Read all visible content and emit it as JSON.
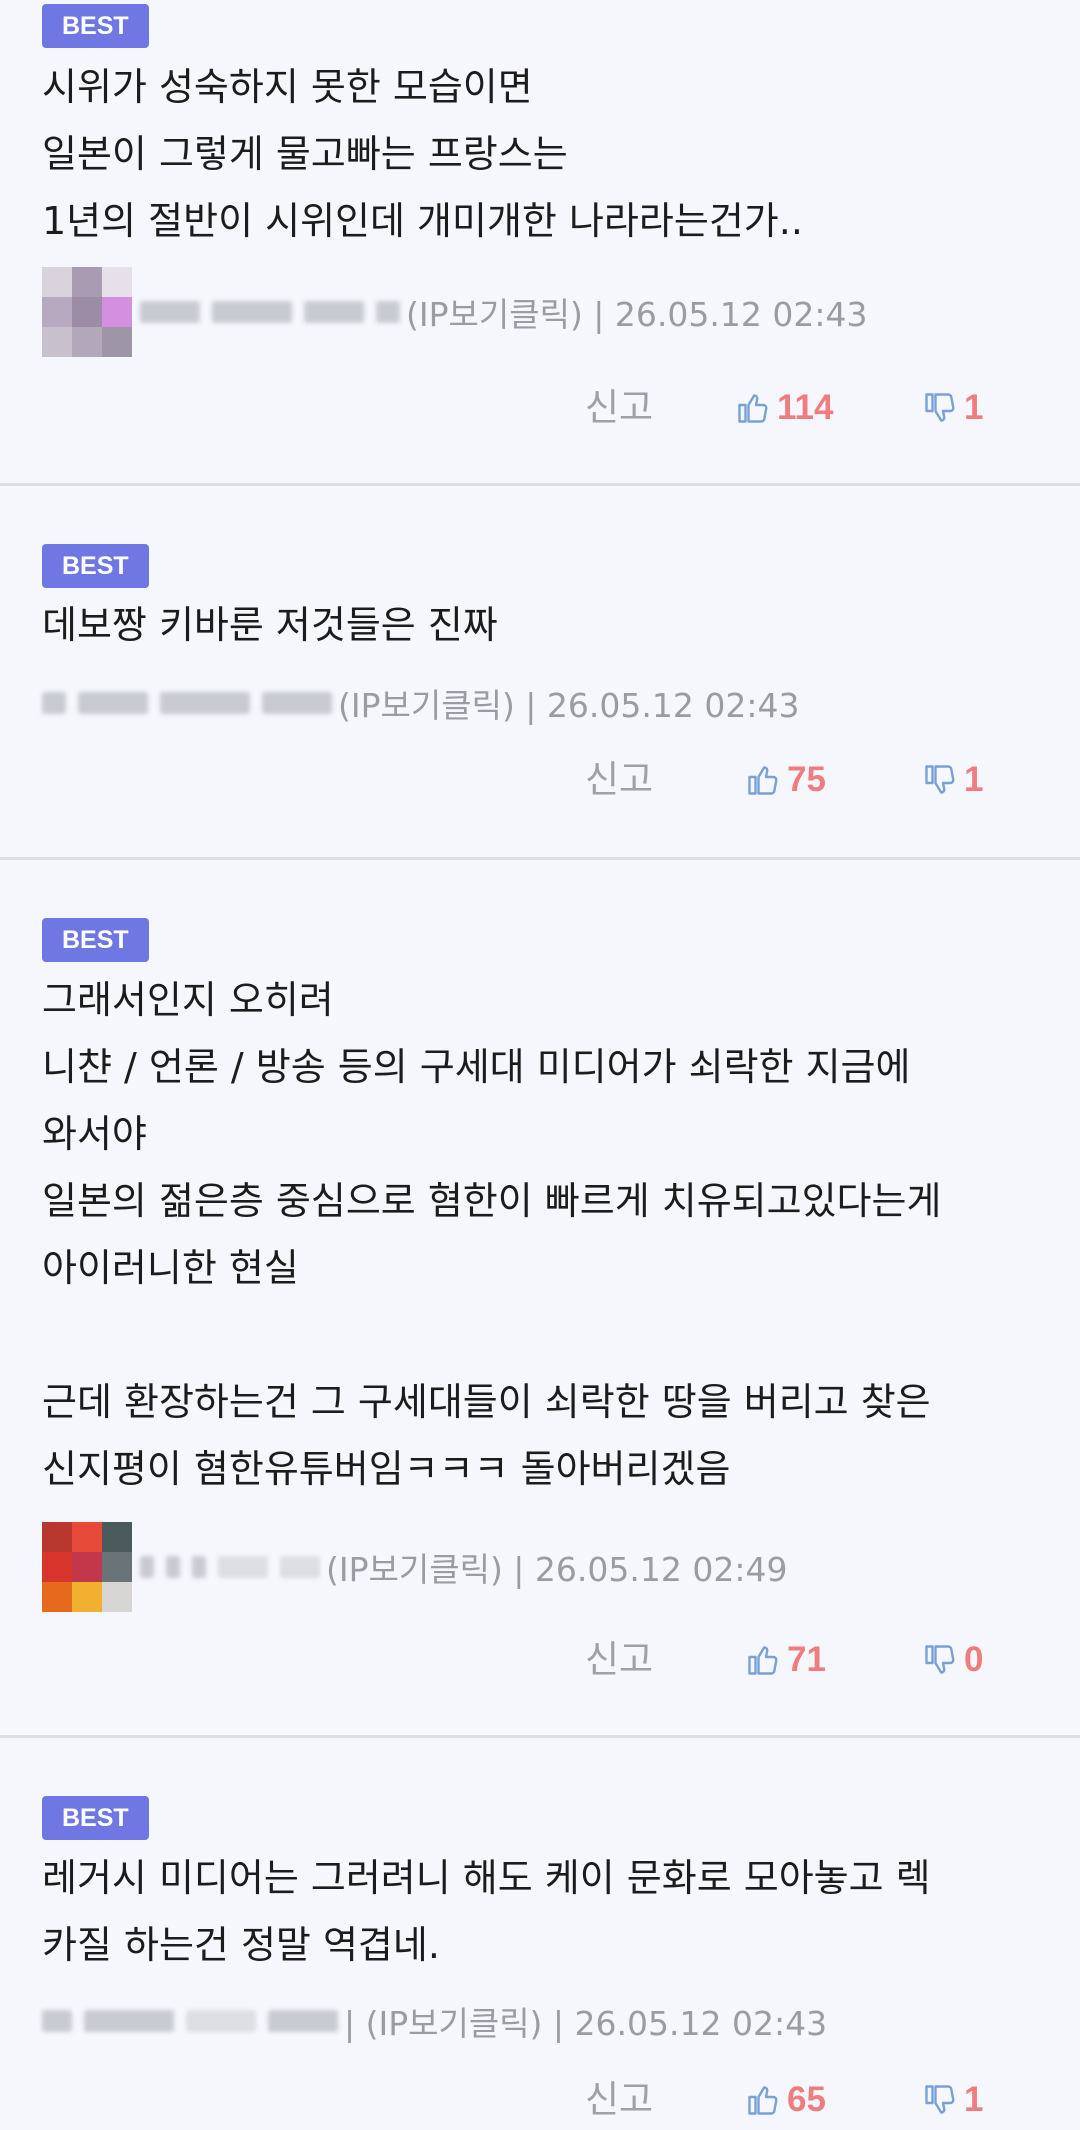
{
  "report_label": "신고",
  "badge_label": "BEST",
  "comments": [
    {
      "lines": [
        "시위가 성숙하지 못한 모습이면",
        "일본이 그렇게 물고빠는 프랑스는",
        "1년의 절반이 시위인데 개미개한 나라라는건가.."
      ],
      "meta": "(IP보기클릭) | 26.05.12 02:43",
      "likes": "114",
      "dislikes": "1"
    },
    {
      "lines": [
        "데보짱 키바룬 저것들은 진짜"
      ],
      "meta": "(IP보기클릭) | 26.05.12 02:43",
      "likes": "75",
      "dislikes": "1"
    },
    {
      "lines": [
        "그래서인지 오히려",
        "니챤 / 언론 / 방송 등의 구세대 미디어가 쇠락한 지금에",
        "와서야",
        "일본의 젊은층 중심으로 혐한이 빠르게 치유되고있다는게",
        "아이러니한 현실",
        "",
        "근데 환장하는건 그 구세대들이 쇠락한 땅을 버리고 찾은",
        "신지평이 혐한유튜버임ㅋㅋㅋ 돌아버리겠음"
      ],
      "meta": "(IP보기클릭) | 26.05.12 02:49",
      "likes": "71",
      "dislikes": "0"
    },
    {
      "lines": [
        "레거시 미디어는 그러려니 해도 케이 문화로 모아놓고 렉",
        "카질 하는건 정말 역겹네."
      ],
      "meta": "| (IP보기클릭) | 26.05.12 02:43",
      "likes": "65",
      "dislikes": "1"
    }
  ],
  "colors": {
    "badge": "#6f77e3",
    "count": "#ef7d7f",
    "thumb": "#7aa0d8",
    "meta": "#9a9ca3"
  }
}
